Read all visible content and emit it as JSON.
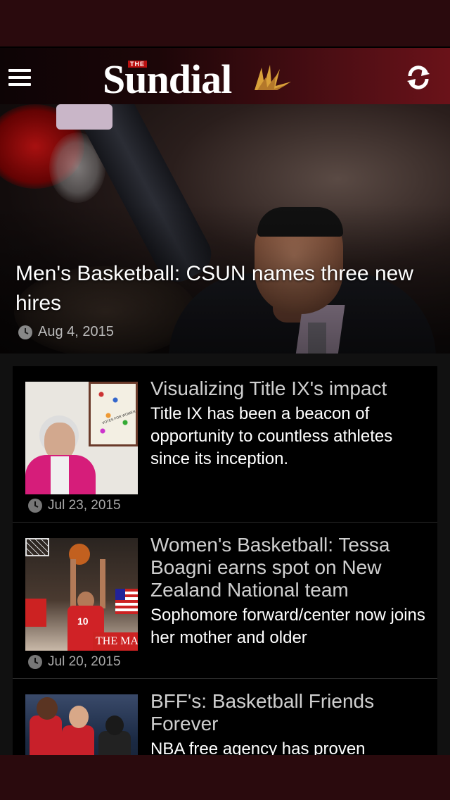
{
  "app": {
    "logo_small": "THE",
    "logo_text": "Sundial",
    "brand_color": "#6a1219"
  },
  "hero": {
    "title": "Men's Basketball: CSUN names three new hires",
    "date": "Aug 4, 2015"
  },
  "articles": [
    {
      "title": "Visualizing Title IX's impact",
      "excerpt": "Title IX has been a beacon of opportunity to countless athletes since its inception.",
      "date": "Jul 23, 2015",
      "thumb_caption": "VOTES FOR WOMEN"
    },
    {
      "title": "Women's Basketball: Tessa Boagni earns spot on New Zealand National team",
      "excerpt": "Sophomore forward/center now joins her mother and older",
      "date": "Jul 20, 2015",
      "thumb_jersey": "10",
      "thumb_banner": "THE MA"
    },
    {
      "title": "BFF's: Basketball Friends Forever",
      "excerpt": "NBA free agency has proven",
      "date": ""
    }
  ],
  "icons": {
    "menu": "hamburger-menu-icon",
    "refresh": "refresh-icon",
    "date": "clock-icon"
  }
}
